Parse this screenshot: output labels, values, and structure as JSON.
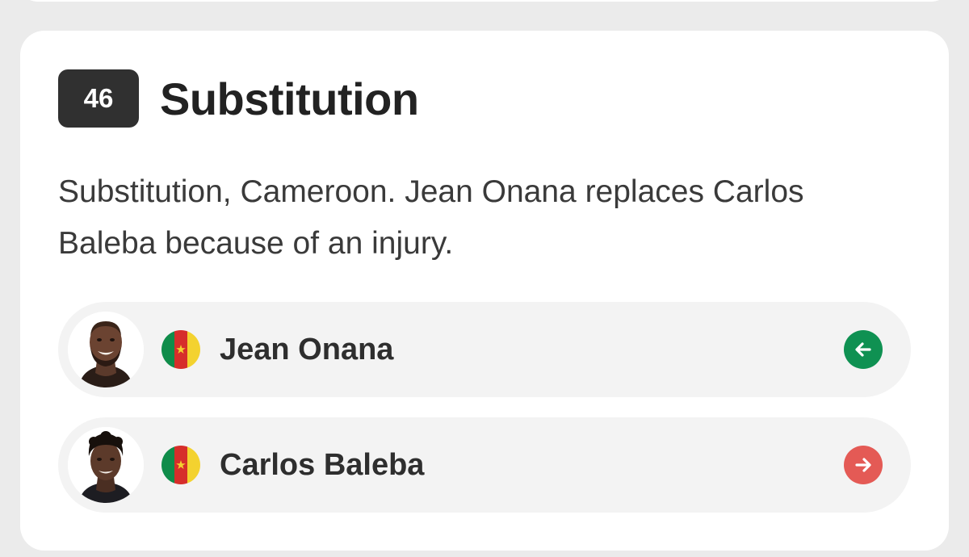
{
  "event": {
    "minute": "46",
    "title": "Substitution",
    "description": "Substitution, Cameroon. Jean Onana replaces Carlos Baleba because of an injury."
  },
  "players": [
    {
      "name": "Jean Onana",
      "country_flag": "cameroon-flag",
      "direction_icon": "arrow-left-icon",
      "direction_color": "#0f9152",
      "status": "in"
    },
    {
      "name": "Carlos Baleba",
      "country_flag": "cameroon-flag",
      "direction_icon": "arrow-right-icon",
      "direction_color": "#e45a55",
      "status": "out"
    }
  ],
  "colors": {
    "badge_background": "#303030",
    "card_background": "#ffffff",
    "row_background": "#f3f3f3",
    "page_background": "#ebebeb"
  }
}
